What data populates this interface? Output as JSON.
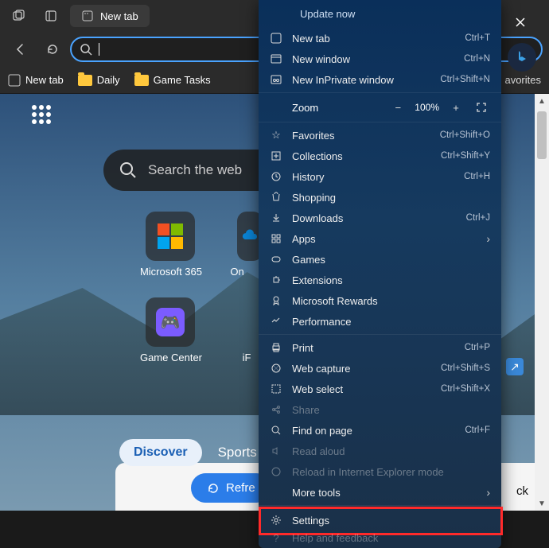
{
  "titlebar": {
    "tab_label": "New tab",
    "close_x": "✕"
  },
  "navbar": {
    "search_placeholder": ""
  },
  "favorites": {
    "newtab": "New tab",
    "daily": "Daily",
    "gametasks": "Game Tasks",
    "overflow": "avorites"
  },
  "ntp": {
    "search_placeholder": "Search the web",
    "tile_ms365": "Microsoft 365",
    "tile_on": "On",
    "tile_gamecenter": "Game Center",
    "tile_ip": "iF",
    "discover": "Discover",
    "sports": "Sports",
    "refresh": "Refre",
    "ext_badge": "↗",
    "ck": "ck"
  },
  "menu": {
    "update": "Update now",
    "newtab": {
      "label": "New tab",
      "short": "Ctrl+T"
    },
    "newwindow": {
      "label": "New window",
      "short": "Ctrl+N"
    },
    "inprivate": {
      "label": "New InPrivate window",
      "short": "Ctrl+Shift+N"
    },
    "zoom": {
      "label": "Zoom",
      "value": "100%"
    },
    "favorites": {
      "label": "Favorites",
      "short": "Ctrl+Shift+O"
    },
    "collections": {
      "label": "Collections",
      "short": "Ctrl+Shift+Y"
    },
    "history": {
      "label": "History",
      "short": "Ctrl+H"
    },
    "shopping": {
      "label": "Shopping"
    },
    "downloads": {
      "label": "Downloads",
      "short": "Ctrl+J"
    },
    "apps": {
      "label": "Apps"
    },
    "games": {
      "label": "Games"
    },
    "extensions": {
      "label": "Extensions"
    },
    "rewards": {
      "label": "Microsoft Rewards"
    },
    "performance": {
      "label": "Performance"
    },
    "print": {
      "label": "Print",
      "short": "Ctrl+P"
    },
    "webcapture": {
      "label": "Web capture",
      "short": "Ctrl+Shift+S"
    },
    "webselect": {
      "label": "Web select",
      "short": "Ctrl+Shift+X"
    },
    "share": {
      "label": "Share"
    },
    "findonpage": {
      "label": "Find on page",
      "short": "Ctrl+F"
    },
    "readaloud": {
      "label": "Read aloud"
    },
    "reloadie": {
      "label": "Reload in Internet Explorer mode"
    },
    "moretools": {
      "label": "More tools"
    },
    "settings": {
      "label": "Settings"
    },
    "help": {
      "label": "Help and feedback"
    }
  }
}
